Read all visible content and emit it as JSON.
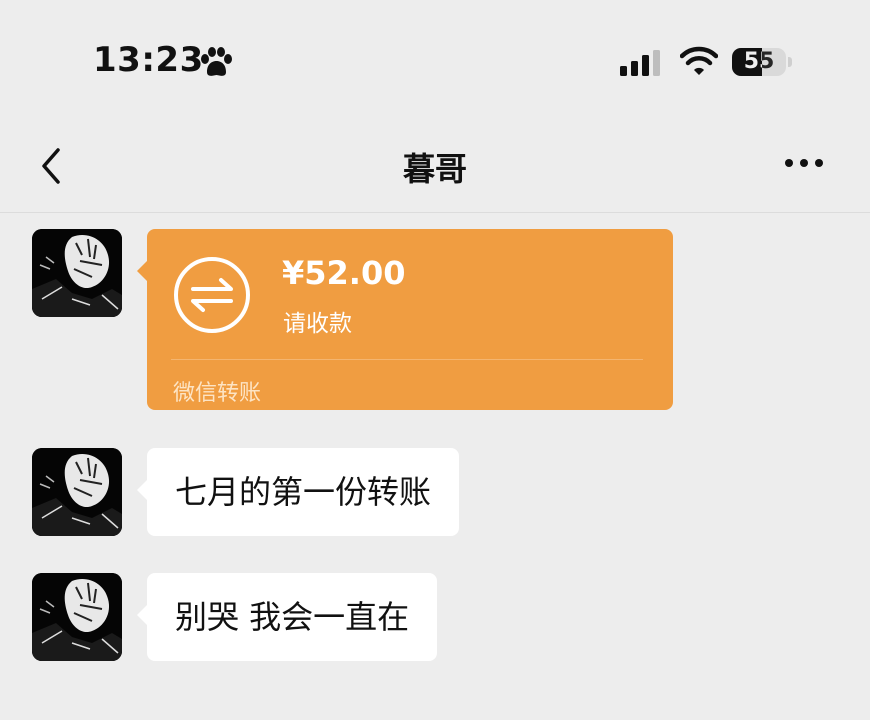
{
  "status_bar": {
    "time": "13:23",
    "battery_level": "55",
    "icons": [
      "paw-icon",
      "signal-icon",
      "wifi-icon",
      "battery-icon"
    ]
  },
  "nav": {
    "title": "暮哥",
    "back_icon": "chevron-left-icon",
    "more_icon": "more-dots-icon"
  },
  "messages": [
    {
      "type": "transfer",
      "amount": "¥52.00",
      "status": "请收款",
      "footer": "微信转账",
      "color": "#f09d41"
    },
    {
      "type": "text",
      "text": "七月的第一份转账"
    },
    {
      "type": "text",
      "text": "别哭 我会一直在"
    }
  ],
  "colors": {
    "background": "#ededed",
    "bubble": "#ffffff",
    "transfer": "#f09d41"
  }
}
